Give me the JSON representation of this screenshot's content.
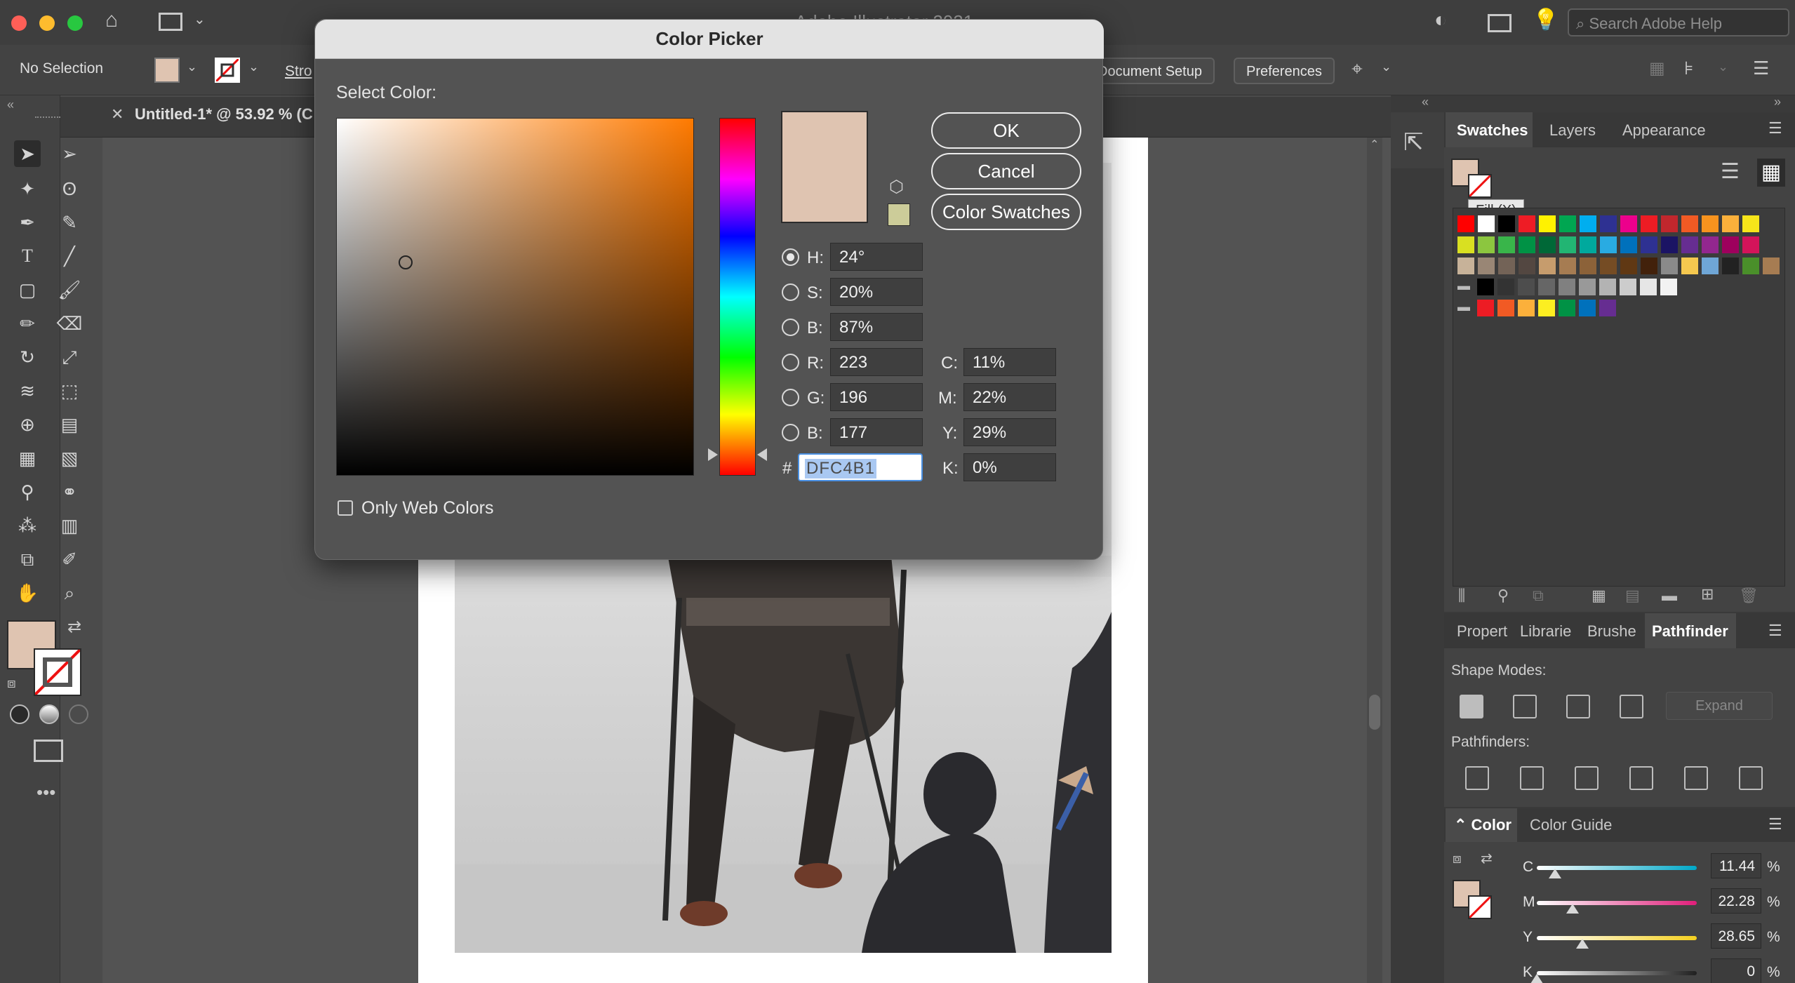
{
  "window": {
    "title": "Adobe Illustrator 2021"
  },
  "search": {
    "placeholder": "Search Adobe Help"
  },
  "controlbar": {
    "selection_label": "No Selection",
    "stroke_label": "Stro",
    "document_setup_label": "Document Setup",
    "preferences_label": "Preferences"
  },
  "document": {
    "tab_title": "Untitled-1* @ 53.92 % (C"
  },
  "colors": {
    "fill": "#DFC4B1",
    "accent_blue": "#4a90e2",
    "web_safe_swatch": "#CCCC99"
  },
  "dialog": {
    "title": "Color Picker",
    "select_color_label": "Select Color:",
    "ok_label": "OK",
    "cancel_label": "Cancel",
    "color_swatches_label": "Color Swatches",
    "fields": {
      "H": {
        "label": "H:",
        "value": "24°",
        "selected": true
      },
      "S": {
        "label": "S:",
        "value": "20%"
      },
      "Bri": {
        "label": "B:",
        "value": "87%"
      },
      "R": {
        "label": "R:",
        "value": "223"
      },
      "G": {
        "label": "G:",
        "value": "196"
      },
      "Blu": {
        "label": "B:",
        "value": "177"
      },
      "C": {
        "label": "C:",
        "value": "11%"
      },
      "M": {
        "label": "M:",
        "value": "22%"
      },
      "Y": {
        "label": "Y:",
        "value": "29%"
      },
      "K": {
        "label": "K:",
        "value": "0%"
      }
    },
    "hex_label": "#",
    "hex_value": "DFC4B1",
    "only_web_colors_label": "Only Web Colors"
  },
  "swatches_panel": {
    "tabs": [
      "Swatches",
      "Layers",
      "Appearance"
    ],
    "tooltip": "Fill (X)",
    "rows": [
      [
        "#ff0000",
        "#ffffff",
        "#000000",
        "#ee1c25",
        "#fff200",
        "#00a651",
        "#00aeef",
        "#2e3192",
        "#ec008c",
        "#ed1c24",
        "#c1272d",
        "#f15a24",
        "#f7931e",
        "#fbb03b",
        "#f7e51a"
      ],
      [
        "#d9e021",
        "#8cc63f",
        "#39b54a",
        "#009245",
        "#006837",
        "#22b573",
        "#00a99d",
        "#29abe2",
        "#0071bc",
        "#2e3192",
        "#1b1464",
        "#662d91",
        "#93278f",
        "#9e005d",
        "#d4145a"
      ],
      [
        "#c7b299",
        "#998675",
        "#736357",
        "#534741",
        "#c69c6d",
        "#a67c52",
        "#8c6239",
        "#754c24",
        "#603813",
        "#42210b",
        "#8a8a8a",
        "#f5c84f",
        "#6fa6d6",
        "#222222",
        "#4a8f2a",
        "#a67c52"
      ],
      [
        "#000000",
        "#333333",
        "#4d4d4d",
        "#666666",
        "#808080",
        "#999999",
        "#b3b3b3",
        "#cccccc",
        "#e6e6e6",
        "#f2f2f2"
      ],
      [
        "#ed1c24",
        "#f15a24",
        "#fbb03b",
        "#fcee21",
        "#009245",
        "#0071bc",
        "#662d91"
      ]
    ]
  },
  "lower_panel": {
    "tabs": [
      "Propert",
      "Librarie",
      "Brushe",
      "Pathfinder"
    ],
    "shape_modes_label": "Shape Modes:",
    "expand_label": "Expand",
    "pathfinders_label": "Pathfinders:"
  },
  "color_panel": {
    "tabs": [
      "Color",
      "Color Guide"
    ],
    "channels": [
      {
        "label": "C",
        "value": "11.44",
        "unit": "%",
        "fraction": 0.1144,
        "from": "#ffffff",
        "to": "#00a8c8"
      },
      {
        "label": "M",
        "value": "22.28",
        "unit": "%",
        "fraction": 0.2228,
        "from": "#ffffff",
        "to": "#e01e7a"
      },
      {
        "label": "Y",
        "value": "28.65",
        "unit": "%",
        "fraction": 0.2865,
        "from": "#ffffff",
        "to": "#f4d020"
      },
      {
        "label": "K",
        "value": "0",
        "unit": "%",
        "fraction": 0.0,
        "from": "#ffffff",
        "to": "#202020"
      }
    ]
  }
}
